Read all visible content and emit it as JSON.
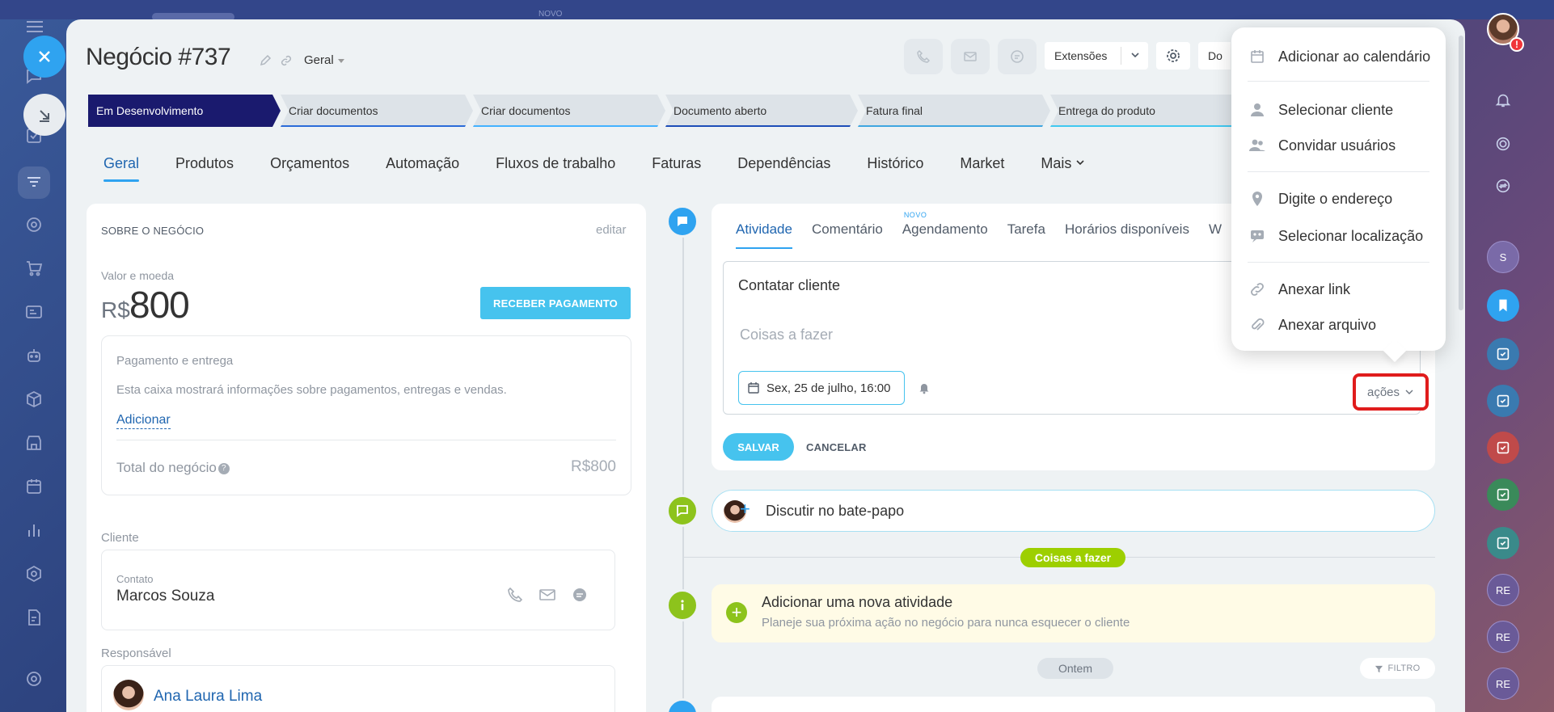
{
  "topbar": {
    "new_label": "NOVO"
  },
  "deal": {
    "title": "Negócio #737",
    "category": "Geral",
    "extensions_label": "Extensões",
    "doc_label": "Do"
  },
  "stages": [
    "Em Desenvolvimento",
    "Criar documentos",
    "Criar documentos",
    "Documento aberto",
    "Fatura final",
    "Entrega do produto"
  ],
  "tabs": [
    "Geral",
    "Produtos",
    "Orçamentos",
    "Automação",
    "Fluxos de trabalho",
    "Faturas",
    "Dependências",
    "Histórico",
    "Market",
    "Mais"
  ],
  "about": {
    "heading": "SOBRE O NEGÓCIO",
    "edit": "editar",
    "value_label": "Valor e moeda",
    "currency": "R$",
    "amount": "800",
    "pay_button": "RECEBER PAGAMENTO",
    "payment_title": "Pagamento e entrega",
    "payment_desc": "Esta caixa mostrará informações sobre pagamentos, entregas e vendas.",
    "payment_add": "Adicionar",
    "total_label": "Total do negócio",
    "total_value": "R$800",
    "client_label": "Cliente",
    "contact_label": "Contato",
    "contact_name": "Marcos Souza",
    "responsible_label": "Responsável",
    "responsible_name": "Ana Laura Lima"
  },
  "activity": {
    "tabs": [
      "Atividade",
      "Comentário",
      "Agendamento",
      "Tarefa",
      "Horários disponíveis",
      "W"
    ],
    "novo_badge": "NOVO",
    "title_value": "Contatar cliente",
    "placeholder": "Coisas a fazer",
    "date": "Sex, 25 de julho, 16:00",
    "actions": "ações",
    "save": "SALVAR",
    "cancel": "CANCELAR"
  },
  "chat": {
    "label": "Discutir no bate-papo"
  },
  "timeline": {
    "todo_pill": "Coisas a fazer",
    "new_activity_title": "Adicionar uma nova atividade",
    "new_activity_sub": "Planeje sua próxima ação no negócio para nunca esquecer o cliente",
    "yesterday": "Ontem",
    "filter": "FILTRO"
  },
  "menu": {
    "items": [
      "Adicionar ao calendário",
      "Selecionar cliente",
      "Convidar usuários",
      "Digite o endereço",
      "Selecionar localização",
      "Anexar link",
      "Anexar arquivo"
    ]
  },
  "right_sidebar": {
    "alert": "!",
    "initials": [
      "S",
      "RE",
      "RE",
      "RE"
    ]
  },
  "colors": {
    "accent": "#2fa3f0",
    "active_stage": "#1a1a6e",
    "pay_button": "#46c3ee",
    "todo_green": "#9dcf00",
    "highlight_red": "#e01c1c"
  }
}
